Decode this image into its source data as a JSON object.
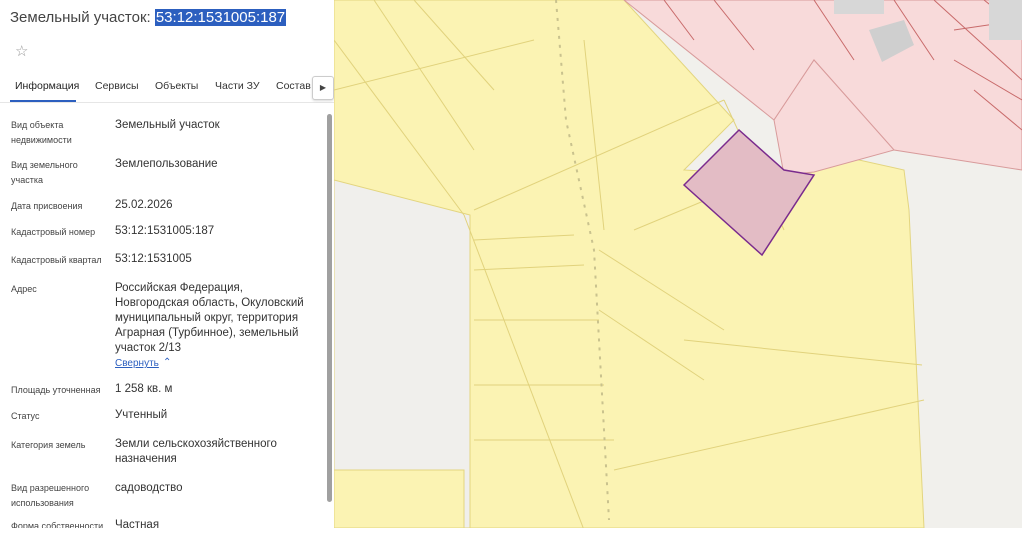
{
  "header": {
    "title_prefix": "Земельный участок: ",
    "title_number": "53:12:1531005:187"
  },
  "tabs": [
    {
      "label": "Информация"
    },
    {
      "label": "Сервисы"
    },
    {
      "label": "Объекты"
    },
    {
      "label": "Части ЗУ"
    },
    {
      "label": "Состав"
    }
  ],
  "info": [
    {
      "label": "Вид объекта недвижимости",
      "value": "Земельный участок"
    },
    {
      "label": "Вид земельного участка",
      "value": "Землепользование"
    },
    {
      "label": "Дата присвоения",
      "value": "25.02.2026"
    },
    {
      "label": "Кадастровый номер",
      "value": "53:12:1531005:187"
    },
    {
      "label": "Кадастровый квартал",
      "value": "53:12:1531005"
    },
    {
      "label": "Адрес",
      "value": "Российская Федерация, Новгородская область, Окуловский муниципальный округ, территория Аграрная (Турбинное), земельный участок 2/13"
    },
    {
      "label": "Площадь уточненная",
      "value": "1 258 кв. м"
    },
    {
      "label": "Статус",
      "value": "Учтенный"
    },
    {
      "label": "Категория земель",
      "value": "Земли сельскохозяйственного назначения"
    },
    {
      "label": "Вид разрешенного использования",
      "value": "садоводство"
    },
    {
      "label": "Форма собственности",
      "value": "Частная"
    }
  ],
  "collapse_link": "Свернуть",
  "colors": {
    "accent": "#2c5fbf",
    "parcel_fill": "#fbf3b3",
    "parcel_stroke": "#e0d27a",
    "selected_fill": "#e0b8c2",
    "selected_stroke": "#7a2a8a",
    "building_fill": "#f7dcdc",
    "building_stroke": "#d99a9a"
  },
  "icons": {
    "favorite": "star-outline-icon",
    "tabs_scroll": "chevron-right-icon",
    "collapse": "chevron-up-icon"
  }
}
